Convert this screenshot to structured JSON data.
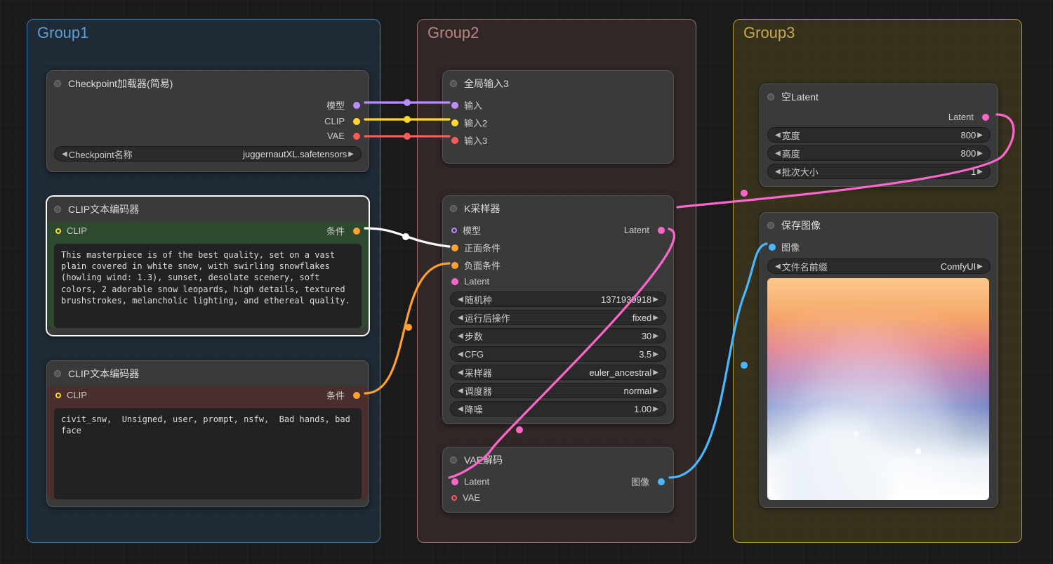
{
  "groups": {
    "g1": {
      "label": "Group1"
    },
    "g2": {
      "label": "Group2"
    },
    "g3": {
      "label": "Group3"
    }
  },
  "nodes": {
    "checkpoint_loader": {
      "title": "Checkpoint加载器(简易)",
      "out_model": "模型",
      "out_clip": "CLIP",
      "out_vae": "VAE",
      "widget_label": "Checkpoint名称",
      "widget_value": "juggernautXL.safetensors"
    },
    "clip_pos": {
      "title": "CLIP文本编码器",
      "in_clip": "CLIP",
      "out_cond": "条件",
      "text": "This masterpiece is of the best quality, set on a vast plain covered in white snow, with swirling snowflakes (howling wind: 1.3), sunset, desolate scenery, soft colors, 2 adorable snow leopards, high details, textured brushstrokes, melancholic lighting, and ethereal quality."
    },
    "clip_neg": {
      "title": "CLIP文本编码器",
      "in_clip": "CLIP",
      "out_cond": "条件",
      "text": "civit_snw,  Unsigned, user, prompt, nsfw,  Bad hands, bad face"
    },
    "global_in": {
      "title": "全局输入3",
      "in1": "输入",
      "in2": "输入2",
      "in3": "输入3"
    },
    "ksampler": {
      "title": "K采样器",
      "in_model": "模型",
      "in_pos": "正面条件",
      "in_neg": "负面条件",
      "in_latent": "Latent",
      "out_latent": "Latent",
      "w_seed_l": "随机种",
      "w_seed_v": "1371939918",
      "w_after_l": "运行后操作",
      "w_after_v": "fixed",
      "w_steps_l": "步数",
      "w_steps_v": "30",
      "w_cfg_l": "CFG",
      "w_cfg_v": "3.5",
      "w_sampler_l": "采样器",
      "w_sampler_v": "euler_ancestral",
      "w_sched_l": "调度器",
      "w_sched_v": "normal",
      "w_denoise_l": "降噪",
      "w_denoise_v": "1.00"
    },
    "vae_decode": {
      "title": "VAE解码",
      "in_latent": "Latent",
      "in_vae": "VAE",
      "out_image": "图像"
    },
    "empty_latent": {
      "title": "空Latent",
      "out_latent": "Latent",
      "w_w_l": "宽度",
      "w_w_v": "800",
      "w_h_l": "高度",
      "w_h_v": "800",
      "w_b_l": "批次大小",
      "w_b_v": "1"
    },
    "save_image": {
      "title": "保存图像",
      "in_image": "图像",
      "w_prefix_l": "文件名前缀",
      "w_prefix_v": "ComfyUI"
    }
  }
}
